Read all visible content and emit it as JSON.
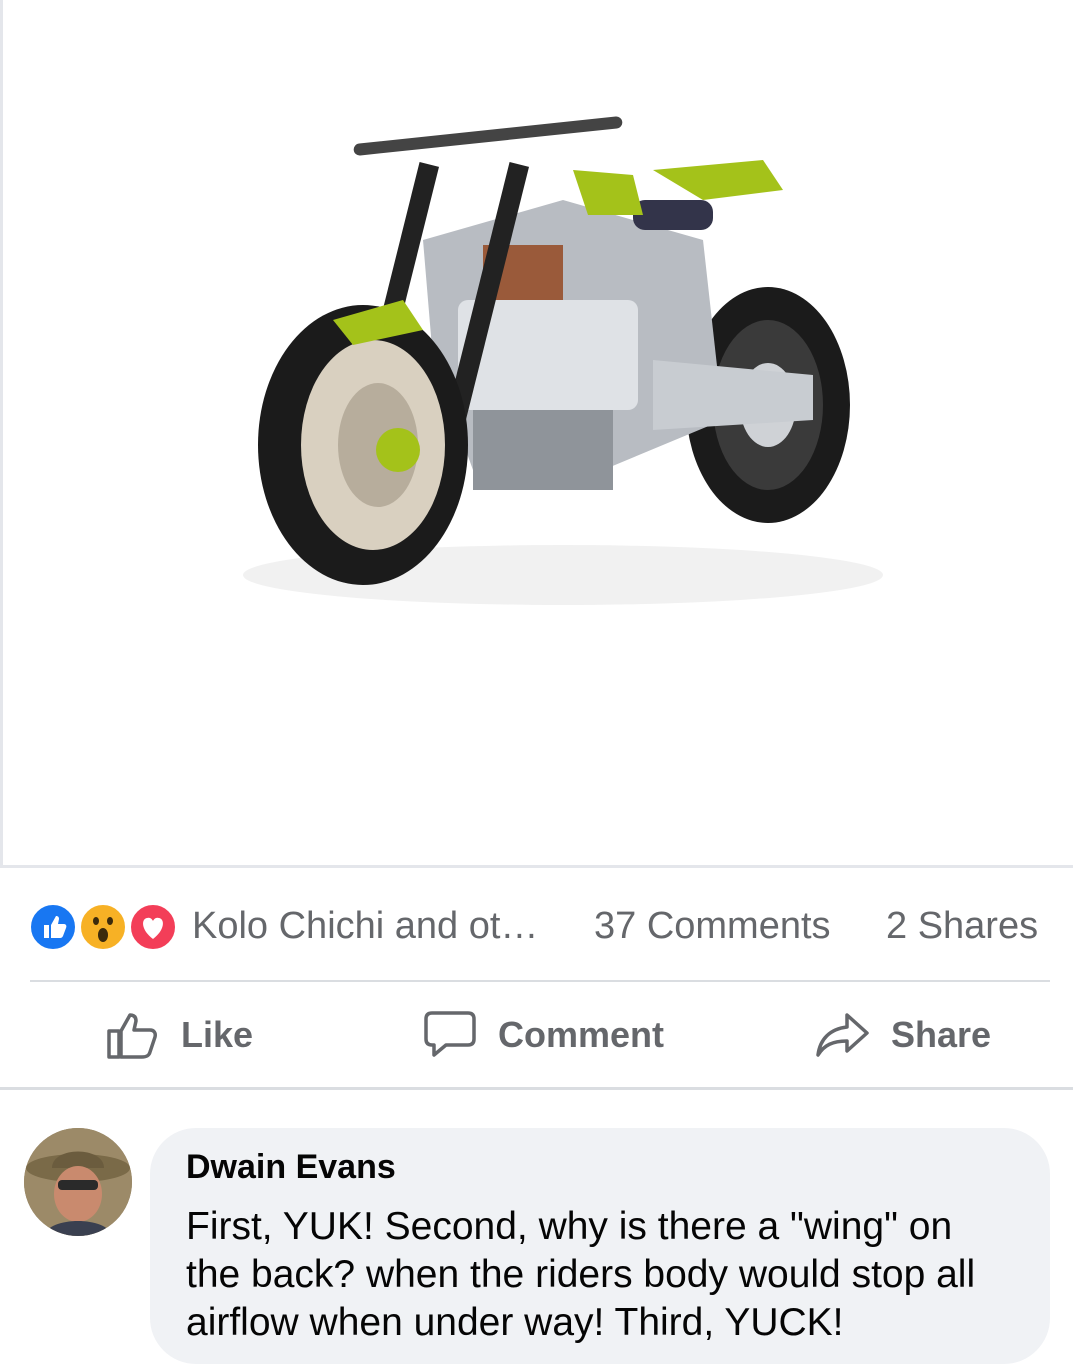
{
  "post": {
    "image": {
      "description_icon": "motorcycle-photo"
    },
    "reactions": {
      "icons": [
        "like-icon",
        "wow-icon",
        "love-icon"
      ],
      "colors": {
        "like": "#1877f2",
        "wow": "#f7b125",
        "love": "#f33e58"
      },
      "reactor_text": "Kolo Chichi and ot…"
    },
    "comments_count": "37 Comments",
    "shares_count": "2 Shares"
  },
  "actions": {
    "like_label": "Like",
    "comment_label": "Comment",
    "share_label": "Share"
  },
  "comment": {
    "author": "Dwain Evans",
    "text": "First, YUK! Second, why is there a \"wing\" on the back? when the riders body would stop all airflow when under way! Third, YUCK!"
  }
}
